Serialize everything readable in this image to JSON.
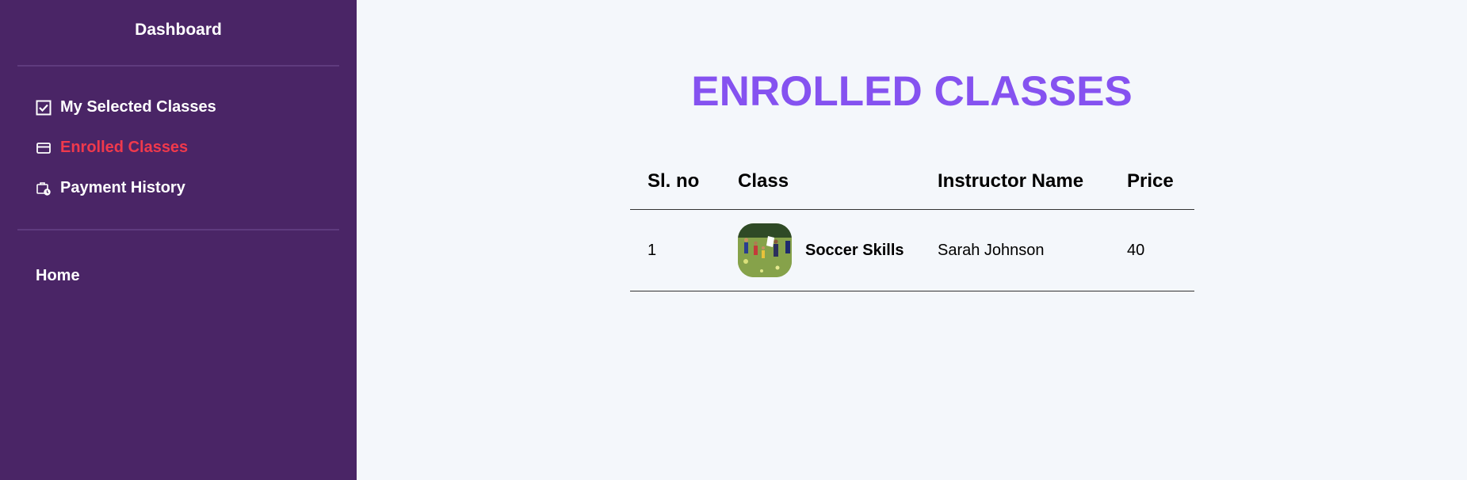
{
  "sidebar": {
    "title": "Dashboard",
    "items": [
      {
        "label": "My Selected Classes",
        "icon": "checkbox-icon",
        "active": false
      },
      {
        "label": "Enrolled Classes",
        "icon": "card-icon",
        "active": true
      },
      {
        "label": "Payment History",
        "icon": "wallet-clock-icon",
        "active": false
      }
    ],
    "home": "Home"
  },
  "main": {
    "title": "ENROLLED CLASSES",
    "table": {
      "headers": [
        "Sl. no",
        "Class",
        "Instructor Name",
        "Price"
      ],
      "rows": [
        {
          "sl": "1",
          "class_name": "Soccer Skills",
          "thumbnail": "soccer-field-image",
          "instructor": "Sarah Johnson",
          "price": "40"
        }
      ]
    }
  },
  "colors": {
    "sidebar_bg": "#4a2566",
    "active_nav": "#f0394c",
    "title": "#8552f0",
    "page_bg": "#f4f7fb"
  }
}
